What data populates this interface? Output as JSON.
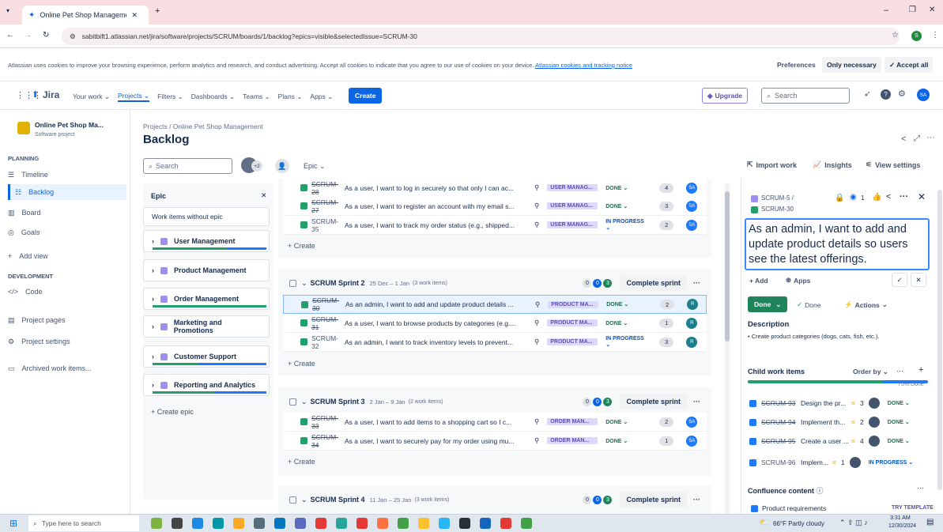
{
  "browser": {
    "tab_title": "Online Pet Shop Management",
    "url": "sabitbift1.atlassian.net/jira/software/projects/SCRUM/boards/1/backlog?epics=visible&selectedIssue=SCRUM-30"
  },
  "cookie": {
    "text": "Atlassian uses cookies to improve your browsing experience, perform analytics and research, and conduct advertising. Accept all cookies to indicate that you agree to our use of cookies on your device.",
    "link": "Atlassian cookies and tracking notice",
    "preferences": "Preferences",
    "only_necessary": "Only necessary",
    "accept_all": "✓ Accept all"
  },
  "nav": {
    "product": "Jira",
    "items": [
      "Your work",
      "Projects",
      "Filters",
      "Dashboards",
      "Teams",
      "Plans",
      "Apps"
    ],
    "create": "Create",
    "upgrade": "Upgrade",
    "search_placeholder": "Search",
    "user_initials": "SA"
  },
  "sidebar": {
    "project_name": "Online Pet Shop Ma...",
    "project_type": "Software project",
    "planning_heading": "PLANNING",
    "planning": [
      "Timeline",
      "Backlog",
      "Board",
      "Goals",
      "Add view"
    ],
    "development_heading": "DEVELOPMENT",
    "development": [
      "Code"
    ],
    "other": [
      "Project pages",
      "Project settings",
      "Archived work items..."
    ]
  },
  "page": {
    "breadcrumb": "Projects / Online Pet Shop Management",
    "title": "Backlog",
    "search_placeholder": "Search",
    "avatar_more": "+2",
    "epic_filter": "Epic",
    "import_work": "Import work",
    "insights": "Insights",
    "view_settings": "View settings"
  },
  "epics": {
    "header": "Epic",
    "without": "Work items without epic",
    "items": [
      "User Management",
      "Product Management",
      "Order Management",
      "Marketing and Promotions",
      "Customer Support",
      "Reporting and Analytics"
    ],
    "create": "+ Create epic"
  },
  "sprint1_issues": [
    {
      "key": "SCRUM-28",
      "summary": "As a user, I want to log in securely so that only I can ac...",
      "epic": "USER MANAG...",
      "status": "DONE",
      "points": "4",
      "assignee": "SA"
    },
    {
      "key": "SCRUM-27",
      "summary": "As a user, I want to register an account with my email s...",
      "epic": "USER MANAG...",
      "status": "DONE",
      "points": "3",
      "assignee": "SA"
    },
    {
      "key": "SCRUM-35",
      "summary": "As a user, I want to track my order status (e.g., shipped...",
      "epic": "USER MANAG...",
      "status": "IN PROGRESS",
      "points": "2",
      "assignee": "SA"
    }
  ],
  "create_label": "+ Create",
  "sprints": [
    {
      "name": "SCRUM Sprint 2",
      "dates": "25 Dec – 1 Jan",
      "count": "(3 work items)",
      "c0": "0",
      "c1": "0",
      "c2": "3",
      "action": "Complete sprint",
      "issues": [
        {
          "key": "SCRUM-30",
          "summary": "As an admin, I want to add and update product details ...",
          "epic": "PRODUCT MA...",
          "status": "DONE",
          "points": "2",
          "assignee": "R"
        },
        {
          "key": "SCRUM-31",
          "summary": "As a user, I want to browse products by categories (e.g....",
          "epic": "PRODUCT MA...",
          "status": "DONE",
          "points": "1",
          "assignee": "R"
        },
        {
          "key": "SCRUM-32",
          "summary": "As an admin, I want to track inventory levels to prevent...",
          "epic": "PRODUCT MA...",
          "status": "IN PROGRESS",
          "points": "3",
          "assignee": "R"
        }
      ]
    },
    {
      "name": "SCRUM Sprint 3",
      "dates": "2 Jan – 9 Jan",
      "count": "(2 work items)",
      "c0": "0",
      "c1": "0",
      "c2": "3",
      "action": "Complete sprint",
      "issues": [
        {
          "key": "SCRUM-33",
          "summary": "As a user, I want to add items to a shopping cart so I c...",
          "epic": "ORDER MAN...",
          "status": "DONE",
          "points": "2",
          "assignee": "SA"
        },
        {
          "key": "SCRUM-34",
          "summary": "As a user, I want to securely pay for my order using mu...",
          "epic": "ORDER MAN...",
          "status": "DONE",
          "points": "1",
          "assignee": "SA"
        }
      ]
    },
    {
      "name": "SCRUM Sprint 4",
      "dates": "11 Jan – 25 Jan",
      "count": "(3 work items)",
      "c0": "0",
      "c1": "0",
      "c2": "3",
      "action": "Complete sprint"
    }
  ],
  "detail": {
    "parent": "SCRUM-5 /",
    "key": "SCRUM-30",
    "watchers": "1",
    "title": "As an admin, I want to add and update product details so users see the latest offerings.",
    "add": "+ Add",
    "apps": "Apps",
    "status_btn": "Done",
    "resolution": "Done",
    "actions": "Actions",
    "desc_heading": "Description",
    "desc_item": "Create product categories (dogs, cats, fish, etc.).",
    "child_heading": "Child work items",
    "order_by": "Order by",
    "progress_label": "75% Done",
    "progress": 0.75,
    "children": [
      {
        "key": "SCRUM-93",
        "summary": "Design the pr...",
        "points": "3",
        "status": "DONE",
        "done": true
      },
      {
        "key": "SCRUM-94",
        "summary": "Implement th...",
        "points": "2",
        "status": "DONE",
        "done": true
      },
      {
        "key": "SCRUM-95",
        "summary": "Create a user ...",
        "points": "4",
        "status": "DONE",
        "done": true
      },
      {
        "key": "SCRUM-96",
        "summary": "Implem...",
        "points": "1",
        "status": "IN PROGRESS",
        "done": false
      }
    ],
    "confluence_heading": "Confluence content",
    "confluence_item": "Product requirements",
    "try_template": "TRY TEMPLATE"
  },
  "taskbar": {
    "search_placeholder": "Type here to search",
    "weather": "66°F Partly cloudy",
    "time": "3:31 AM",
    "date": "12/30/2024"
  },
  "colors": {
    "accent": "#0c66e4",
    "done_green": "#22a06b",
    "epic_purple": "#9f8fef"
  }
}
